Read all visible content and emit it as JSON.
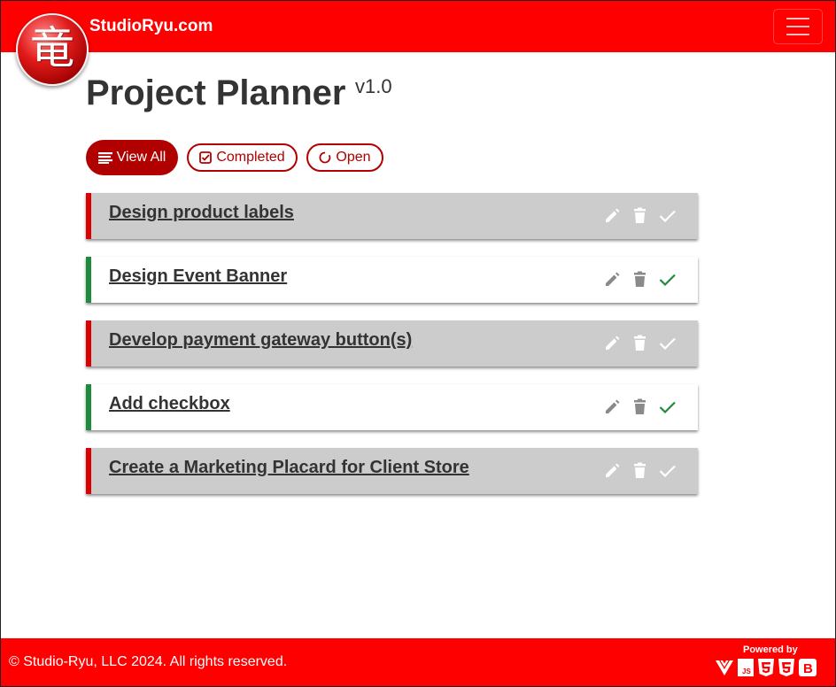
{
  "navbar": {
    "brand_name": "StudioRyu.com",
    "logo_glyph": "竜",
    "menu_icon": "hamburger-icon",
    "accent_color": "#ff0000"
  },
  "header": {
    "title": "Project Planner",
    "version": "v1.0"
  },
  "filters": [
    {
      "label": "View All",
      "icon": "list-icon",
      "active": true
    },
    {
      "label": "Completed",
      "icon": "check-square-icon",
      "active": false
    },
    {
      "label": "Open",
      "icon": "circle-notch-icon",
      "active": false
    }
  ],
  "tasks": [
    {
      "title": "Design product labels",
      "status": "open"
    },
    {
      "title": "Design Event Banner",
      "status": "completed"
    },
    {
      "title": "Develop payment gateway button(s)",
      "status": "open"
    },
    {
      "title": "Add checkbox",
      "status": "completed"
    },
    {
      "title": "Create a Marketing Placard for Client Store",
      "status": "open"
    }
  ],
  "task_actions": [
    "pencil-icon",
    "trash-icon",
    "check-icon"
  ],
  "status_colors": {
    "open": "#dd0000",
    "completed": "#1e8a3c"
  },
  "footer": {
    "copyright": "© Studio-Ryu, LLC 2024. All rights reserved.",
    "powered_by": "Powered by",
    "tech_icons": [
      "vue-icon",
      "javascript-icon",
      "html5-icon",
      "css3-icon",
      "bootstrap-icon"
    ]
  }
}
